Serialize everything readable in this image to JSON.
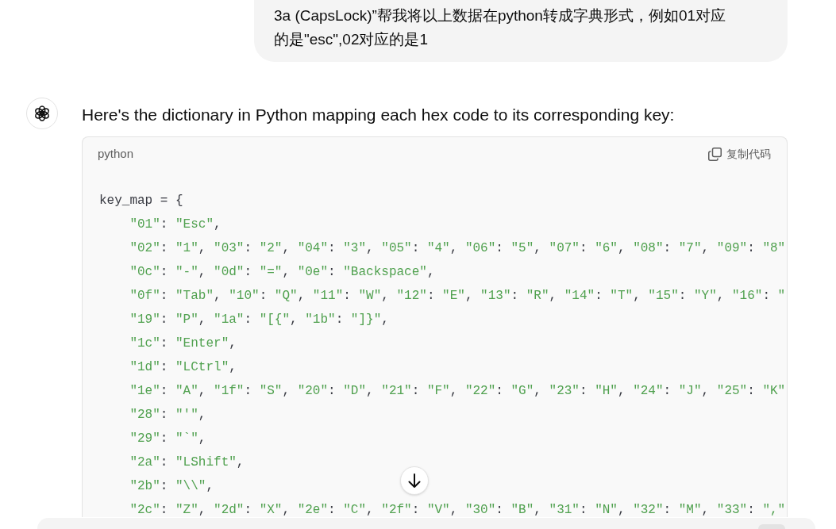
{
  "user_message": {
    "text": "3a (CapsLock)”帮我将以上数据在python转成字典形式，例如01对应的是\"esc\",02对应的是1"
  },
  "assistant": {
    "intro": "Here's the dictionary in Python mapping each hex code to its corresponding key:",
    "code_block": {
      "language": "python",
      "copy_label": "复制代码",
      "lines": [
        "key_map = {",
        "    \"01\": \"Esc\",",
        "    \"02\": \"1\", \"03\": \"2\", \"04\": \"3\", \"05\": \"4\", \"06\": \"5\", \"07\": \"6\", \"08\": \"7\", \"09\": \"8\"",
        "    \"0c\": \"-\", \"0d\": \"=\", \"0e\": \"Backspace\",",
        "    \"0f\": \"Tab\", \"10\": \"Q\", \"11\": \"W\", \"12\": \"E\", \"13\": \"R\", \"14\": \"T\", \"15\": \"Y\", \"16\": \"",
        "    \"19\": \"P\", \"1a\": \"[{\", \"1b\": \"]}\",",
        "    \"1c\": \"Enter\",",
        "    \"1d\": \"LCtrl\",",
        "    \"1e\": \"A\", \"1f\": \"S\", \"20\": \"D\", \"21\": \"F\", \"22\": \"G\", \"23\": \"H\", \"24\": \"J\", \"25\": \"K\"",
        "    \"28\": \"'\",",
        "    \"29\": \"`\",",
        "    \"2a\": \"LShift\",",
        "    \"2b\": \"\\\\\",",
        "    \"2c\": \"Z\", \"2d\": \"X\", \"2e\": \"C\", \"2f\": \"V\", \"30\": \"B\", \"31\": \"N\", \"32\": \"M\", \"33\": \",\""
      ]
    }
  }
}
